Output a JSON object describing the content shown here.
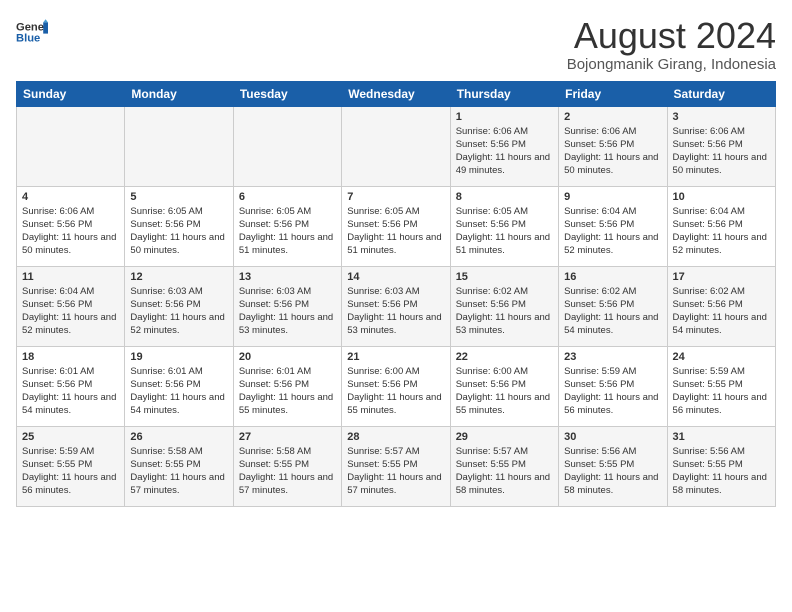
{
  "header": {
    "logo_general": "General",
    "logo_blue": "Blue",
    "calendar_title": "August 2024",
    "calendar_subtitle": "Bojongmanik Girang, Indonesia"
  },
  "weekdays": [
    "Sunday",
    "Monday",
    "Tuesday",
    "Wednesday",
    "Thursday",
    "Friday",
    "Saturday"
  ],
  "weeks": [
    [
      {
        "day": "",
        "sunrise": "",
        "sunset": "",
        "daylight": ""
      },
      {
        "day": "",
        "sunrise": "",
        "sunset": "",
        "daylight": ""
      },
      {
        "day": "",
        "sunrise": "",
        "sunset": "",
        "daylight": ""
      },
      {
        "day": "",
        "sunrise": "",
        "sunset": "",
        "daylight": ""
      },
      {
        "day": "1",
        "sunrise": "Sunrise: 6:06 AM",
        "sunset": "Sunset: 5:56 PM",
        "daylight": "Daylight: 11 hours and 49 minutes."
      },
      {
        "day": "2",
        "sunrise": "Sunrise: 6:06 AM",
        "sunset": "Sunset: 5:56 PM",
        "daylight": "Daylight: 11 hours and 50 minutes."
      },
      {
        "day": "3",
        "sunrise": "Sunrise: 6:06 AM",
        "sunset": "Sunset: 5:56 PM",
        "daylight": "Daylight: 11 hours and 50 minutes."
      }
    ],
    [
      {
        "day": "4",
        "sunrise": "Sunrise: 6:06 AM",
        "sunset": "Sunset: 5:56 PM",
        "daylight": "Daylight: 11 hours and 50 minutes."
      },
      {
        "day": "5",
        "sunrise": "Sunrise: 6:05 AM",
        "sunset": "Sunset: 5:56 PM",
        "daylight": "Daylight: 11 hours and 50 minutes."
      },
      {
        "day": "6",
        "sunrise": "Sunrise: 6:05 AM",
        "sunset": "Sunset: 5:56 PM",
        "daylight": "Daylight: 11 hours and 51 minutes."
      },
      {
        "day": "7",
        "sunrise": "Sunrise: 6:05 AM",
        "sunset": "Sunset: 5:56 PM",
        "daylight": "Daylight: 11 hours and 51 minutes."
      },
      {
        "day": "8",
        "sunrise": "Sunrise: 6:05 AM",
        "sunset": "Sunset: 5:56 PM",
        "daylight": "Daylight: 11 hours and 51 minutes."
      },
      {
        "day": "9",
        "sunrise": "Sunrise: 6:04 AM",
        "sunset": "Sunset: 5:56 PM",
        "daylight": "Daylight: 11 hours and 52 minutes."
      },
      {
        "day": "10",
        "sunrise": "Sunrise: 6:04 AM",
        "sunset": "Sunset: 5:56 PM",
        "daylight": "Daylight: 11 hours and 52 minutes."
      }
    ],
    [
      {
        "day": "11",
        "sunrise": "Sunrise: 6:04 AM",
        "sunset": "Sunset: 5:56 PM",
        "daylight": "Daylight: 11 hours and 52 minutes."
      },
      {
        "day": "12",
        "sunrise": "Sunrise: 6:03 AM",
        "sunset": "Sunset: 5:56 PM",
        "daylight": "Daylight: 11 hours and 52 minutes."
      },
      {
        "day": "13",
        "sunrise": "Sunrise: 6:03 AM",
        "sunset": "Sunset: 5:56 PM",
        "daylight": "Daylight: 11 hours and 53 minutes."
      },
      {
        "day": "14",
        "sunrise": "Sunrise: 6:03 AM",
        "sunset": "Sunset: 5:56 PM",
        "daylight": "Daylight: 11 hours and 53 minutes."
      },
      {
        "day": "15",
        "sunrise": "Sunrise: 6:02 AM",
        "sunset": "Sunset: 5:56 PM",
        "daylight": "Daylight: 11 hours and 53 minutes."
      },
      {
        "day": "16",
        "sunrise": "Sunrise: 6:02 AM",
        "sunset": "Sunset: 5:56 PM",
        "daylight": "Daylight: 11 hours and 54 minutes."
      },
      {
        "day": "17",
        "sunrise": "Sunrise: 6:02 AM",
        "sunset": "Sunset: 5:56 PM",
        "daylight": "Daylight: 11 hours and 54 minutes."
      }
    ],
    [
      {
        "day": "18",
        "sunrise": "Sunrise: 6:01 AM",
        "sunset": "Sunset: 5:56 PM",
        "daylight": "Daylight: 11 hours and 54 minutes."
      },
      {
        "day": "19",
        "sunrise": "Sunrise: 6:01 AM",
        "sunset": "Sunset: 5:56 PM",
        "daylight": "Daylight: 11 hours and 54 minutes."
      },
      {
        "day": "20",
        "sunrise": "Sunrise: 6:01 AM",
        "sunset": "Sunset: 5:56 PM",
        "daylight": "Daylight: 11 hours and 55 minutes."
      },
      {
        "day": "21",
        "sunrise": "Sunrise: 6:00 AM",
        "sunset": "Sunset: 5:56 PM",
        "daylight": "Daylight: 11 hours and 55 minutes."
      },
      {
        "day": "22",
        "sunrise": "Sunrise: 6:00 AM",
        "sunset": "Sunset: 5:56 PM",
        "daylight": "Daylight: 11 hours and 55 minutes."
      },
      {
        "day": "23",
        "sunrise": "Sunrise: 5:59 AM",
        "sunset": "Sunset: 5:56 PM",
        "daylight": "Daylight: 11 hours and 56 minutes."
      },
      {
        "day": "24",
        "sunrise": "Sunrise: 5:59 AM",
        "sunset": "Sunset: 5:55 PM",
        "daylight": "Daylight: 11 hours and 56 minutes."
      }
    ],
    [
      {
        "day": "25",
        "sunrise": "Sunrise: 5:59 AM",
        "sunset": "Sunset: 5:55 PM",
        "daylight": "Daylight: 11 hours and 56 minutes."
      },
      {
        "day": "26",
        "sunrise": "Sunrise: 5:58 AM",
        "sunset": "Sunset: 5:55 PM",
        "daylight": "Daylight: 11 hours and 57 minutes."
      },
      {
        "day": "27",
        "sunrise": "Sunrise: 5:58 AM",
        "sunset": "Sunset: 5:55 PM",
        "daylight": "Daylight: 11 hours and 57 minutes."
      },
      {
        "day": "28",
        "sunrise": "Sunrise: 5:57 AM",
        "sunset": "Sunset: 5:55 PM",
        "daylight": "Daylight: 11 hours and 57 minutes."
      },
      {
        "day": "29",
        "sunrise": "Sunrise: 5:57 AM",
        "sunset": "Sunset: 5:55 PM",
        "daylight": "Daylight: 11 hours and 58 minutes."
      },
      {
        "day": "30",
        "sunrise": "Sunrise: 5:56 AM",
        "sunset": "Sunset: 5:55 PM",
        "daylight": "Daylight: 11 hours and 58 minutes."
      },
      {
        "day": "31",
        "sunrise": "Sunrise: 5:56 AM",
        "sunset": "Sunset: 5:55 PM",
        "daylight": "Daylight: 11 hours and 58 minutes."
      }
    ]
  ]
}
